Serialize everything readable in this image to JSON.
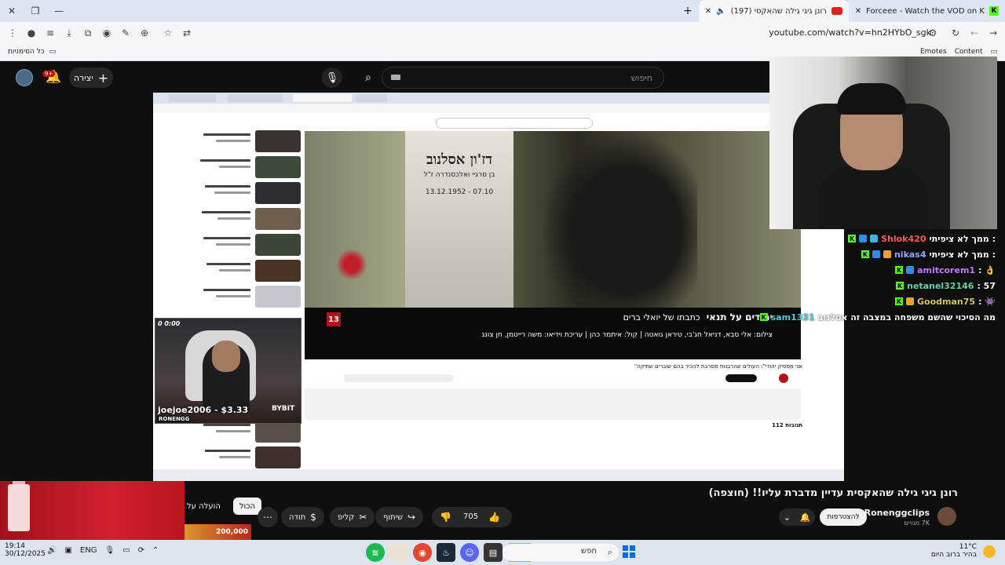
{
  "browser": {
    "tabs": [
      {
        "label": "Forceee - Watch the VOD on K",
        "icon": "kick-icon",
        "active": false
      },
      {
        "label": "(197) רונן גיגי גילה שהאקסי",
        "icon": "youtube-icon",
        "active": true
      }
    ],
    "url": "youtube.com/watch?v=hn2HYbO_sgk",
    "bookmarks_all": "כל הסימניות",
    "bookmark_emotes": "Emotes",
    "bookmark_content": "Content"
  },
  "youtube": {
    "search_placeholder": "חיפוש",
    "create_label": "יצירה",
    "notifications_badge": "9+",
    "video_title": "רונן גיגי גילה שהאקסית עדיין מדברת עליו!! (חוצפה)",
    "channel_name": "Ronenggclips",
    "channel_subs": "7K מנויים",
    "subscribe_label": "להצטרפות",
    "likes": "705",
    "share_label": "שיתוף",
    "clip_label": "קליפ",
    "thanks_label": "תודה",
    "chips": [
      "הכול",
      "הועלה על"
    ],
    "ad_strip_text": "200,000"
  },
  "stream_screen": {
    "headstone_name": "דז'ון אסלנוב",
    "headstone_sub": "בן סרגיי ואלכסנדרה ז\"ל",
    "headstone_date": "13.12.1952 - 07.10",
    "caption_main": "יהודים על תנאי",
    "caption_sub": "כתבתו של יואלי ברים",
    "caption_credits": "צילום: אלי סבא, דניאל חג'בי, טיראן גואטה | קול: איתמר כהן | עריכת וידיאו: משה רייטמן, חן צונג",
    "channel_logo": "13",
    "inner_title": "\"אני מפסיק יהודי\": העולים שהרבנות מסרבת להכיר בהם שוברים שתיקה",
    "comments_count": "112 תגובות",
    "cam_top": "0  0:00",
    "cam_donation": "joejoe2006 - $3.33",
    "cam_brand": "RONENGG",
    "cam_sponsor": "BYBIT"
  },
  "chat": [
    {
      "user": "Shlok420",
      "color": "#ff5a5a",
      "message": "ממך לא ציפיתי :"
    },
    {
      "user": "nikas4",
      "color": "#9aa4ff",
      "message": "ממך לא ציפיתי :"
    },
    {
      "user": "amitcorem1",
      "color": "#c27bff",
      "message": ": 👌"
    },
    {
      "user": "netanel32146",
      "color": "#64d6a8",
      "message": ": 57"
    },
    {
      "user": "Goodman75",
      "color": "#d7c65a",
      "message": ": 👾"
    },
    {
      "user": "sam1331",
      "color": "#56d0d6",
      "message": "מה הסיכוי שהשם משפחה במצבה זה אסלנוב"
    }
  ],
  "taskbar": {
    "time": "19:14",
    "date": "30/12/2025",
    "lang": "ENG",
    "search_placeholder": "חפש",
    "temp": "11°C",
    "weather": "בהיר ברוב היום"
  }
}
